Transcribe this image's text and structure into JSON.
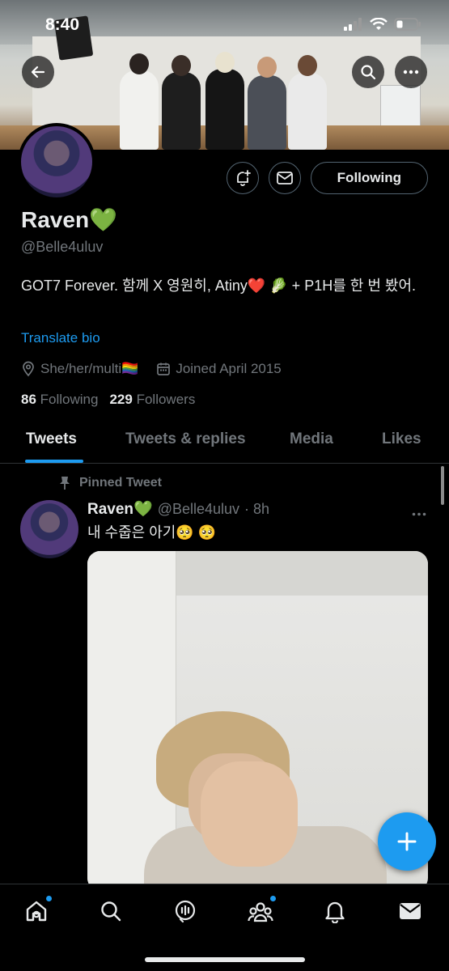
{
  "status_bar": {
    "time": "8:40"
  },
  "header": {
    "back_icon": "arrow-left-icon",
    "search_icon": "search-icon",
    "more_icon": "more-horizontal-icon"
  },
  "profile": {
    "display_name": "Raven💚",
    "handle": "@Belle4uluv",
    "bio": "GOT7 Forever. 함께 X 영원히, Atiny❤️ 🥬 + P1H를 한 번 봤어.",
    "translate_label": "Translate bio",
    "location": "She/her/multi🏳️‍🌈",
    "joined": "Joined April 2015",
    "following_count": "86",
    "following_label": "Following",
    "followers_count": "229",
    "followers_label": "Followers",
    "follow_button_label": "Following"
  },
  "tabs": [
    {
      "label": "Tweets"
    },
    {
      "label": "Tweets & replies"
    },
    {
      "label": "Media"
    },
    {
      "label": "Likes"
    }
  ],
  "tweet": {
    "pinned_label": "Pinned Tweet",
    "name": "Raven💚",
    "handle": "@Belle4uluv",
    "time": "· 8h",
    "text": "내 수줍은 아기🥺 🥺"
  },
  "colors": {
    "accent": "#1d9bf0",
    "background": "#000000",
    "muted": "#71767b"
  }
}
